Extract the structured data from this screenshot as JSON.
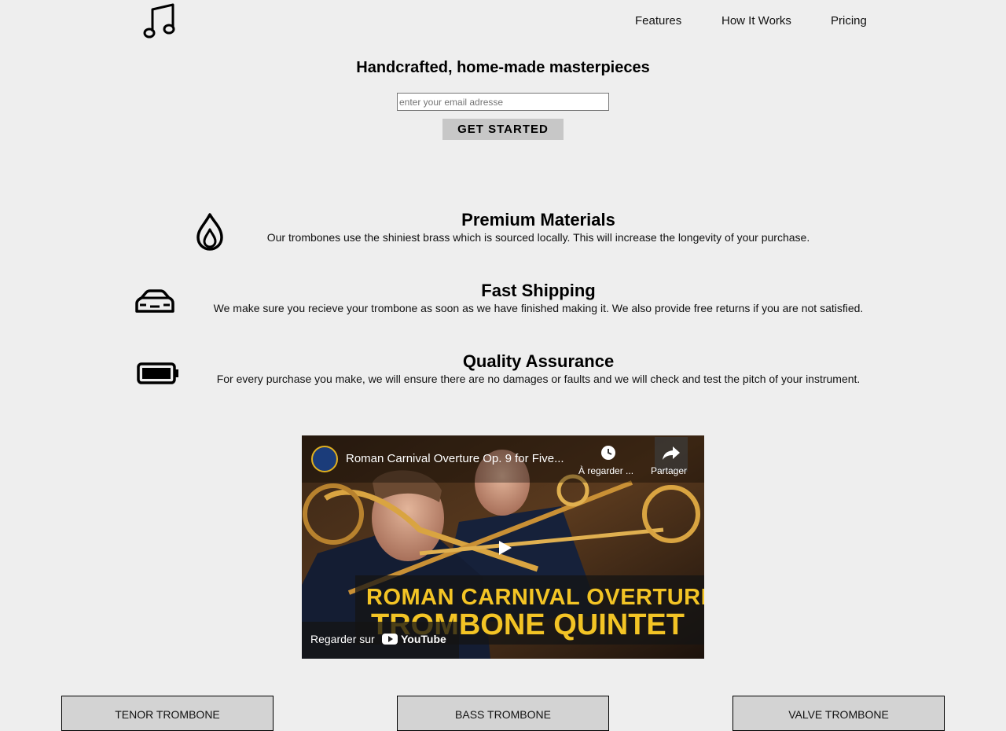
{
  "header": {
    "logo_icon": "music-note-icon",
    "nav": [
      {
        "label": "Features"
      },
      {
        "label": "How It Works"
      },
      {
        "label": "Pricing"
      }
    ]
  },
  "hero": {
    "title": "Handcrafted, home-made masterpieces",
    "email_placeholder": "enter your email adresse",
    "cta_label": "GET STARTED"
  },
  "features": [
    {
      "icon": "flame-icon",
      "title": "Premium Materials",
      "text": "Our trombones use the shiniest brass which is sourced locally. This will increase the longevity of your purchase."
    },
    {
      "icon": "car-icon",
      "title": "Fast Shipping",
      "text": "We make sure you recieve your trombone as soon as we have finished making it. We also provide free returns if you are not satisfied."
    },
    {
      "icon": "battery-icon",
      "title": "Quality Assurance",
      "text": "For every purchase you make, we will ensure there are no damages or faults and we will check and test the pitch of your instrument."
    }
  ],
  "video": {
    "title": "Roman Carnival Overture Op. 9 for Five...",
    "watch_later": "À regarder ...",
    "share": "Partager",
    "overlay_line1": "ROMAN CARNIVAL OVERTURE",
    "overlay_line2": "TROMBONE QUINTET",
    "watch_on": "Regarder sur",
    "youtube": "YouTube"
  },
  "products": [
    {
      "label": "TENOR TROMBONE"
    },
    {
      "label": "BASS TROMBONE"
    },
    {
      "label": "VALVE TROMBONE"
    }
  ],
  "colors": {
    "background": "#eeeeee",
    "button": "#c7c7c7",
    "product_card": "#d3d3d3",
    "video_overlay_text": "#f3c425"
  }
}
